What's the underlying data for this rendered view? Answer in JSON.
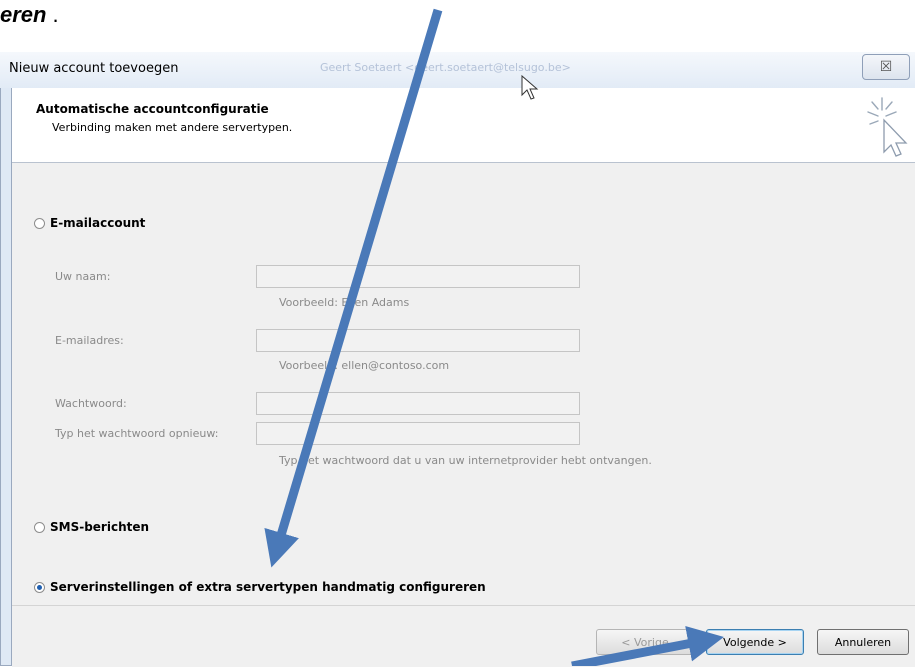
{
  "caption": {
    "text": "eren",
    "trailing": "."
  },
  "window": {
    "title": "Nieuw account toevoegen",
    "blurred_title": "Geert Soetaert <geert.soetaert@telsugo.be>",
    "close_glyph": "☒"
  },
  "header": {
    "title": "Automatische accountconfiguratie",
    "subtitle": "Verbinding maken met andere servertypen."
  },
  "options": {
    "email": {
      "label": "E-mailaccount",
      "checked": false
    },
    "sms": {
      "label": "SMS-berichten",
      "checked": false
    },
    "manual": {
      "label": "Serverinstellingen of extra servertypen handmatig configureren",
      "checked": true
    }
  },
  "fields": {
    "name": {
      "label": "Uw naam:",
      "value": "",
      "hint": "Voorbeeld: Ellen Adams"
    },
    "email": {
      "label": "E-mailadres:",
      "value": "",
      "hint": "Voorbeeld: ellen@contoso.com"
    },
    "password": {
      "label": "Wachtwoord:",
      "value": ""
    },
    "password_repeat": {
      "label": "Typ het wachtwoord opnieuw:",
      "value": "",
      "hint": "Typ het wachtwoord dat u van uw internetprovider hebt ontvangen."
    }
  },
  "buttons": {
    "back": "< Vorige",
    "next": "Volgende >",
    "cancel": "Annuleren"
  },
  "colors": {
    "arrow": "#4a79b8",
    "radio_selected": "#1f5fb0"
  },
  "icons": {
    "wizard": "wizard-cursor-icon",
    "pointer": "mouse-pointer-icon"
  }
}
